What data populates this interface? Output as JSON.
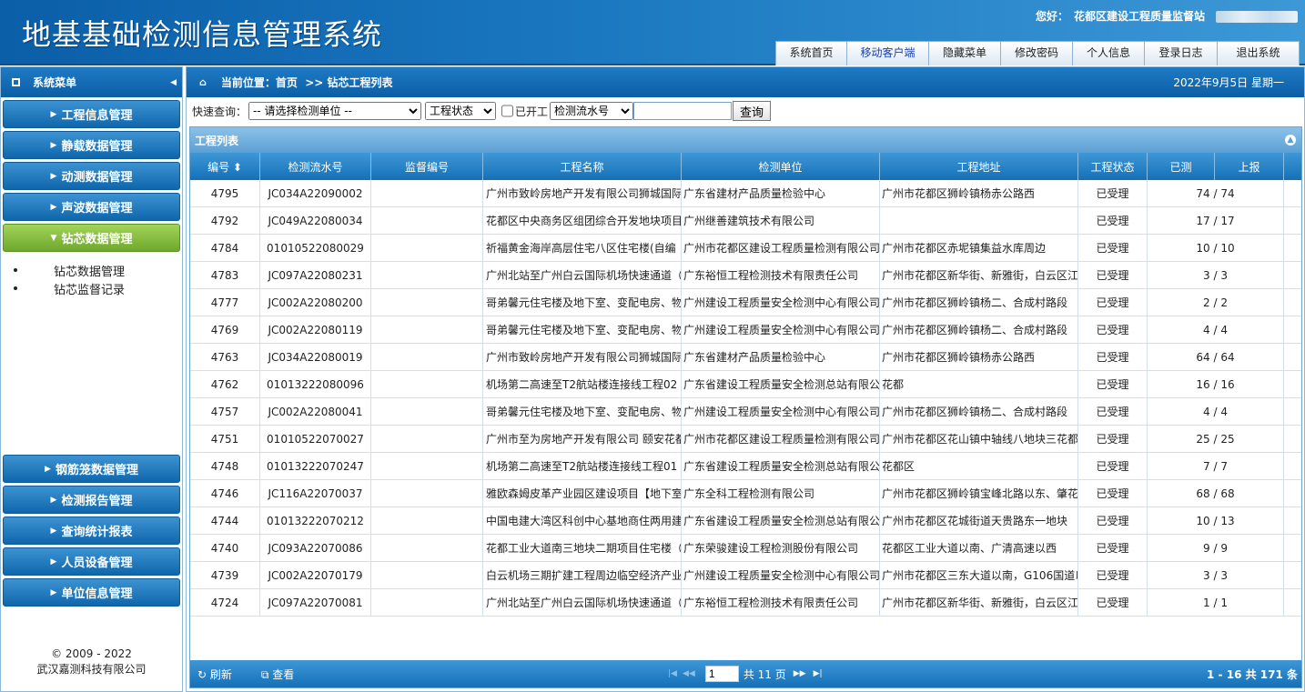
{
  "header": {
    "title": "地基基础检测信息管理系统",
    "greeting": "您好：",
    "org": "花都区建设工程质量监督站",
    "nav": [
      "系统首页",
      "移动客户端",
      "隐藏菜单",
      "修改密码",
      "个人信息",
      "登录日志",
      "退出系统"
    ]
  },
  "sidebar": {
    "title": "系统菜单",
    "menu_top": [
      "工程信息管理",
      "静载数据管理",
      "动测数据管理",
      "声波数据管理",
      "钻芯数据管理"
    ],
    "submenu": [
      "钻芯数据管理",
      "钻芯监督记录"
    ],
    "menu_bottom": [
      "钢筋笼数据管理",
      "检测报告管理",
      "查询统计报表",
      "人员设备管理",
      "单位信息管理"
    ],
    "copyright_line1": "© 2009 - 2022",
    "copyright_line2": "武汉嘉测科技有限公司"
  },
  "breadcrumb": {
    "label": "当前位置：首页",
    "current": ">> 钻芯工程列表",
    "date": "2022年9月5日 星期一"
  },
  "query": {
    "label": "快速查询：",
    "unit_placeholder": "-- 请选择检测单位 --",
    "status_placeholder": "工程状态",
    "started_label": "已开工",
    "field_selected": "检测流水号",
    "button": "查询"
  },
  "grid": {
    "title": "工程列表",
    "columns": [
      "编号 ⬍",
      "检测流水号",
      "监督编号",
      "工程名称",
      "检测单位",
      "工程地址",
      "工程状态",
      "已测",
      "上报"
    ],
    "rows": [
      {
        "id": "4795",
        "flow": "JC034A22090002",
        "sup": "",
        "name": "广州市致岭房地产开发有限公司狮城国际",
        "unit": "广东省建材产品质量检验中心",
        "addr": "广州市花都区狮岭镇杨赤公路西",
        "status": "已受理",
        "tested": "74 / 74"
      },
      {
        "id": "4792",
        "flow": "JC049A22080034",
        "sup": "",
        "name": "花都区中央商务区组团综合开发地块项目",
        "unit": "广州继善建筑技术有限公司",
        "addr": "",
        "status": "已受理",
        "tested": "17 / 17"
      },
      {
        "id": "4784",
        "flow": "01010522080029",
        "sup": "",
        "name": "祈福黄金海岸高层住宅八区住宅楼(自编",
        "unit": "广州市花都区建设工程质量检测有限公司",
        "addr": "广州市花都区赤坭镇集益水库周边",
        "status": "已受理",
        "tested": "10 / 10"
      },
      {
        "id": "4783",
        "flow": "JC097A22080231",
        "sup": "",
        "name": "广州北站至广州白云国际机场快速通道（",
        "unit": "广东裕恒工程检测技术有限责任公司",
        "addr": "广州市花都区新华街、新雅街，白云区江",
        "status": "已受理",
        "tested": "3 / 3"
      },
      {
        "id": "4777",
        "flow": "JC002A22080200",
        "sup": "",
        "name": "哥弟馨元住宅楼及地下室、变配电房、物",
        "unit": "广州建设工程质量安全检测中心有限公司",
        "addr": "广州市花都区狮岭镇杨二、合成村路段",
        "status": "已受理",
        "tested": "2 / 2"
      },
      {
        "id": "4769",
        "flow": "JC002A22080119",
        "sup": "",
        "name": "哥弟馨元住宅楼及地下室、变配电房、物",
        "unit": "广州建设工程质量安全检测中心有限公司",
        "addr": "广州市花都区狮岭镇杨二、合成村路段",
        "status": "已受理",
        "tested": "4 / 4"
      },
      {
        "id": "4763",
        "flow": "JC034A22080019",
        "sup": "",
        "name": "广州市致岭房地产开发有限公司狮城国际",
        "unit": "广东省建材产品质量检验中心",
        "addr": "广州市花都区狮岭镇杨赤公路西",
        "status": "已受理",
        "tested": "64 / 64"
      },
      {
        "id": "4762",
        "flow": "01013222080096",
        "sup": "",
        "name": "机场第二高速至T2航站楼连接线工程02",
        "unit": "广东省建设工程质量安全检测总站有限公",
        "addr": "花都",
        "status": "已受理",
        "tested": "16 / 16"
      },
      {
        "id": "4757",
        "flow": "JC002A22080041",
        "sup": "",
        "name": "哥弟馨元住宅楼及地下室、变配电房、物",
        "unit": "广州建设工程质量安全检测中心有限公司",
        "addr": "广州市花都区狮岭镇杨二、合成村路段",
        "status": "已受理",
        "tested": "4 / 4"
      },
      {
        "id": "4751",
        "flow": "01010522070027",
        "sup": "",
        "name": "广州市至为房地产开发有限公司 颐安花都",
        "unit": "广州市花都区建设工程质量检测有限公司",
        "addr": "广州市花都区花山镇中轴线八地块三花都",
        "status": "已受理",
        "tested": "25 / 25"
      },
      {
        "id": "4748",
        "flow": "01013222070247",
        "sup": "",
        "name": "机场第二高速至T2航站楼连接线工程01",
        "unit": "广东省建设工程质量安全检测总站有限公",
        "addr": "花都区",
        "status": "已受理",
        "tested": "7 / 7"
      },
      {
        "id": "4746",
        "flow": "JC116A22070037",
        "sup": "",
        "name": "雅欧森姆皮革产业园区建设项目【地下室",
        "unit": "广东全科工程检测有限公司",
        "addr": "广州市花都区狮岭镇宝峰北路以东、肇花",
        "status": "已受理",
        "tested": "68 / 68"
      },
      {
        "id": "4744",
        "flow": "01013222070212",
        "sup": "",
        "name": "中国电建大湾区科创中心基地商住两用建",
        "unit": "广东省建设工程质量安全检测总站有限公",
        "addr": "广州市花都区花城街道天贵路东一地块",
        "status": "已受理",
        "tested": "10 / 13"
      },
      {
        "id": "4740",
        "flow": "JC093A22070086",
        "sup": "",
        "name": "花都工业大道南三地块二期项目住宅楼（",
        "unit": "广东荣骏建设工程检测股份有限公司",
        "addr": "花都区工业大道以南、广清高速以西",
        "status": "已受理",
        "tested": "9 / 9"
      },
      {
        "id": "4739",
        "flow": "JC002A22070179",
        "sup": "",
        "name": "白云机场三期扩建工程周边临空经济产业",
        "unit": "广州建设工程质量安全检测中心有限公司",
        "addr": "广州市花都区三东大道以南，G106国道以",
        "status": "已受理",
        "tested": "3 / 3"
      },
      {
        "id": "4724",
        "flow": "JC097A22070081",
        "sup": "",
        "name": "广州北站至广州白云国际机场快速通道（",
        "unit": "广东裕恒工程检测技术有限责任公司",
        "addr": "广州市花都区新华街、新雅街，白云区江",
        "status": "已受理",
        "tested": "1 / 1"
      }
    ]
  },
  "pager": {
    "refresh": "刷新",
    "view": "查看",
    "page": "1",
    "total_pages": "共 11 页",
    "summary": "1 - 16  共 171 条"
  }
}
